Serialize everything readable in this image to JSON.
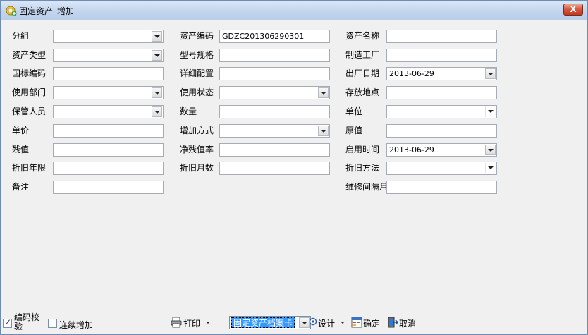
{
  "window": {
    "title": "固定资产_增加",
    "close_label": "X"
  },
  "form": {
    "group_label": "分組",
    "asset_code_label": "资产编码",
    "asset_code_value": "GDZC201306290301",
    "asset_name_label": "资产名称",
    "asset_type_label": "资产类型",
    "model_label": "型号规格",
    "manufacturer_label": "制造工厂",
    "national_code_label": "国标编码",
    "config_label": "详细配置",
    "factory_date_label": "出厂日期",
    "factory_date_value": "2013-06-29",
    "dept_label": "使用部门",
    "use_status_label": "使用状态",
    "location_label": "存放地点",
    "keeper_label": "保管人员",
    "quantity_label": "数量",
    "unit_label": "单位",
    "price_label": "单价",
    "add_method_label": "增加方式",
    "original_value_label": "原值",
    "residual_label": "残值",
    "net_residual_rate_label": "净残值率",
    "start_date_label": "启用时间",
    "start_date_value": "2013-06-29",
    "dep_years_label": "折旧年限",
    "dep_months_label": "折旧月数",
    "dep_method_label": "折旧方法",
    "remark_label": "备注",
    "maintenance_label": "维修间隔月"
  },
  "bottombar": {
    "code_check_label": "编码校验",
    "code_check_checked": true,
    "continuous_label": "连续增加",
    "continuous_checked": false,
    "print_label": "打印",
    "report_selected": "固定资产档案卡",
    "design_label": "设计",
    "confirm_label": "确定",
    "cancel_label": "取消"
  },
  "colors": {
    "titlebar": "#c3d5ee",
    "close": "#c2391e",
    "selection": "#3399ff"
  }
}
